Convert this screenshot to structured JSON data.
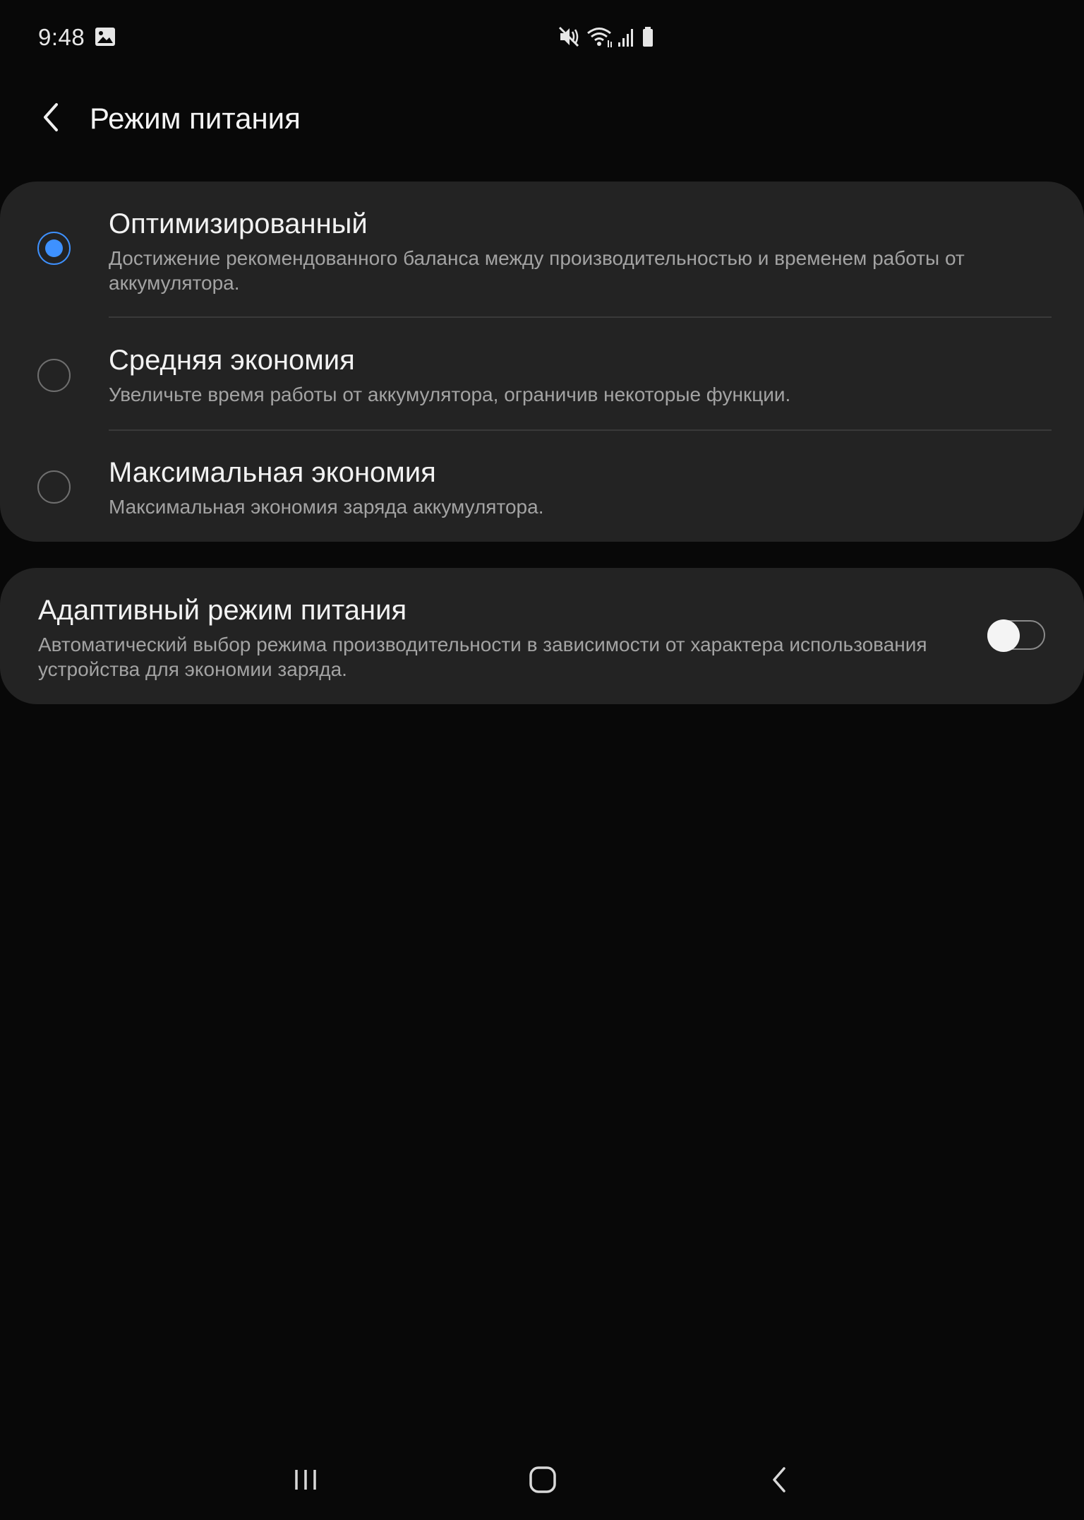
{
  "status_bar": {
    "time": "9:48",
    "icons": [
      "gallery-icon",
      "mute-icon",
      "wifi-icon",
      "signal-icon",
      "battery-icon"
    ]
  },
  "header": {
    "title": "Режим питания",
    "back_icon": "chevron-left-icon"
  },
  "power_modes": {
    "selected_index": 0,
    "items": [
      {
        "title": "Оптимизированный",
        "description": "Достижение рекомендованного баланса между производительностью и временем работы от аккумулятора.",
        "selected": true
      },
      {
        "title": "Средняя экономия",
        "description": "Увеличьте время работы от аккумулятора, ограничив некоторые функции.",
        "selected": false
      },
      {
        "title": "Максимальная экономия",
        "description": "Максимальная экономия заряда аккумулятора.",
        "selected": false
      }
    ]
  },
  "adaptive_mode": {
    "title": "Адаптивный режим питания",
    "description": "Автоматический выбор режима производительности в зависимости от характера использования устройства для экономии заряда.",
    "enabled": false
  },
  "colors": {
    "background": "#080808",
    "card": "#232323",
    "accent": "#3e91ff",
    "primary_text": "#f2f2f2",
    "secondary_text": "#a3a3a3"
  },
  "nav_bar": {
    "icons": [
      "recents-icon",
      "home-icon",
      "back-icon"
    ]
  }
}
